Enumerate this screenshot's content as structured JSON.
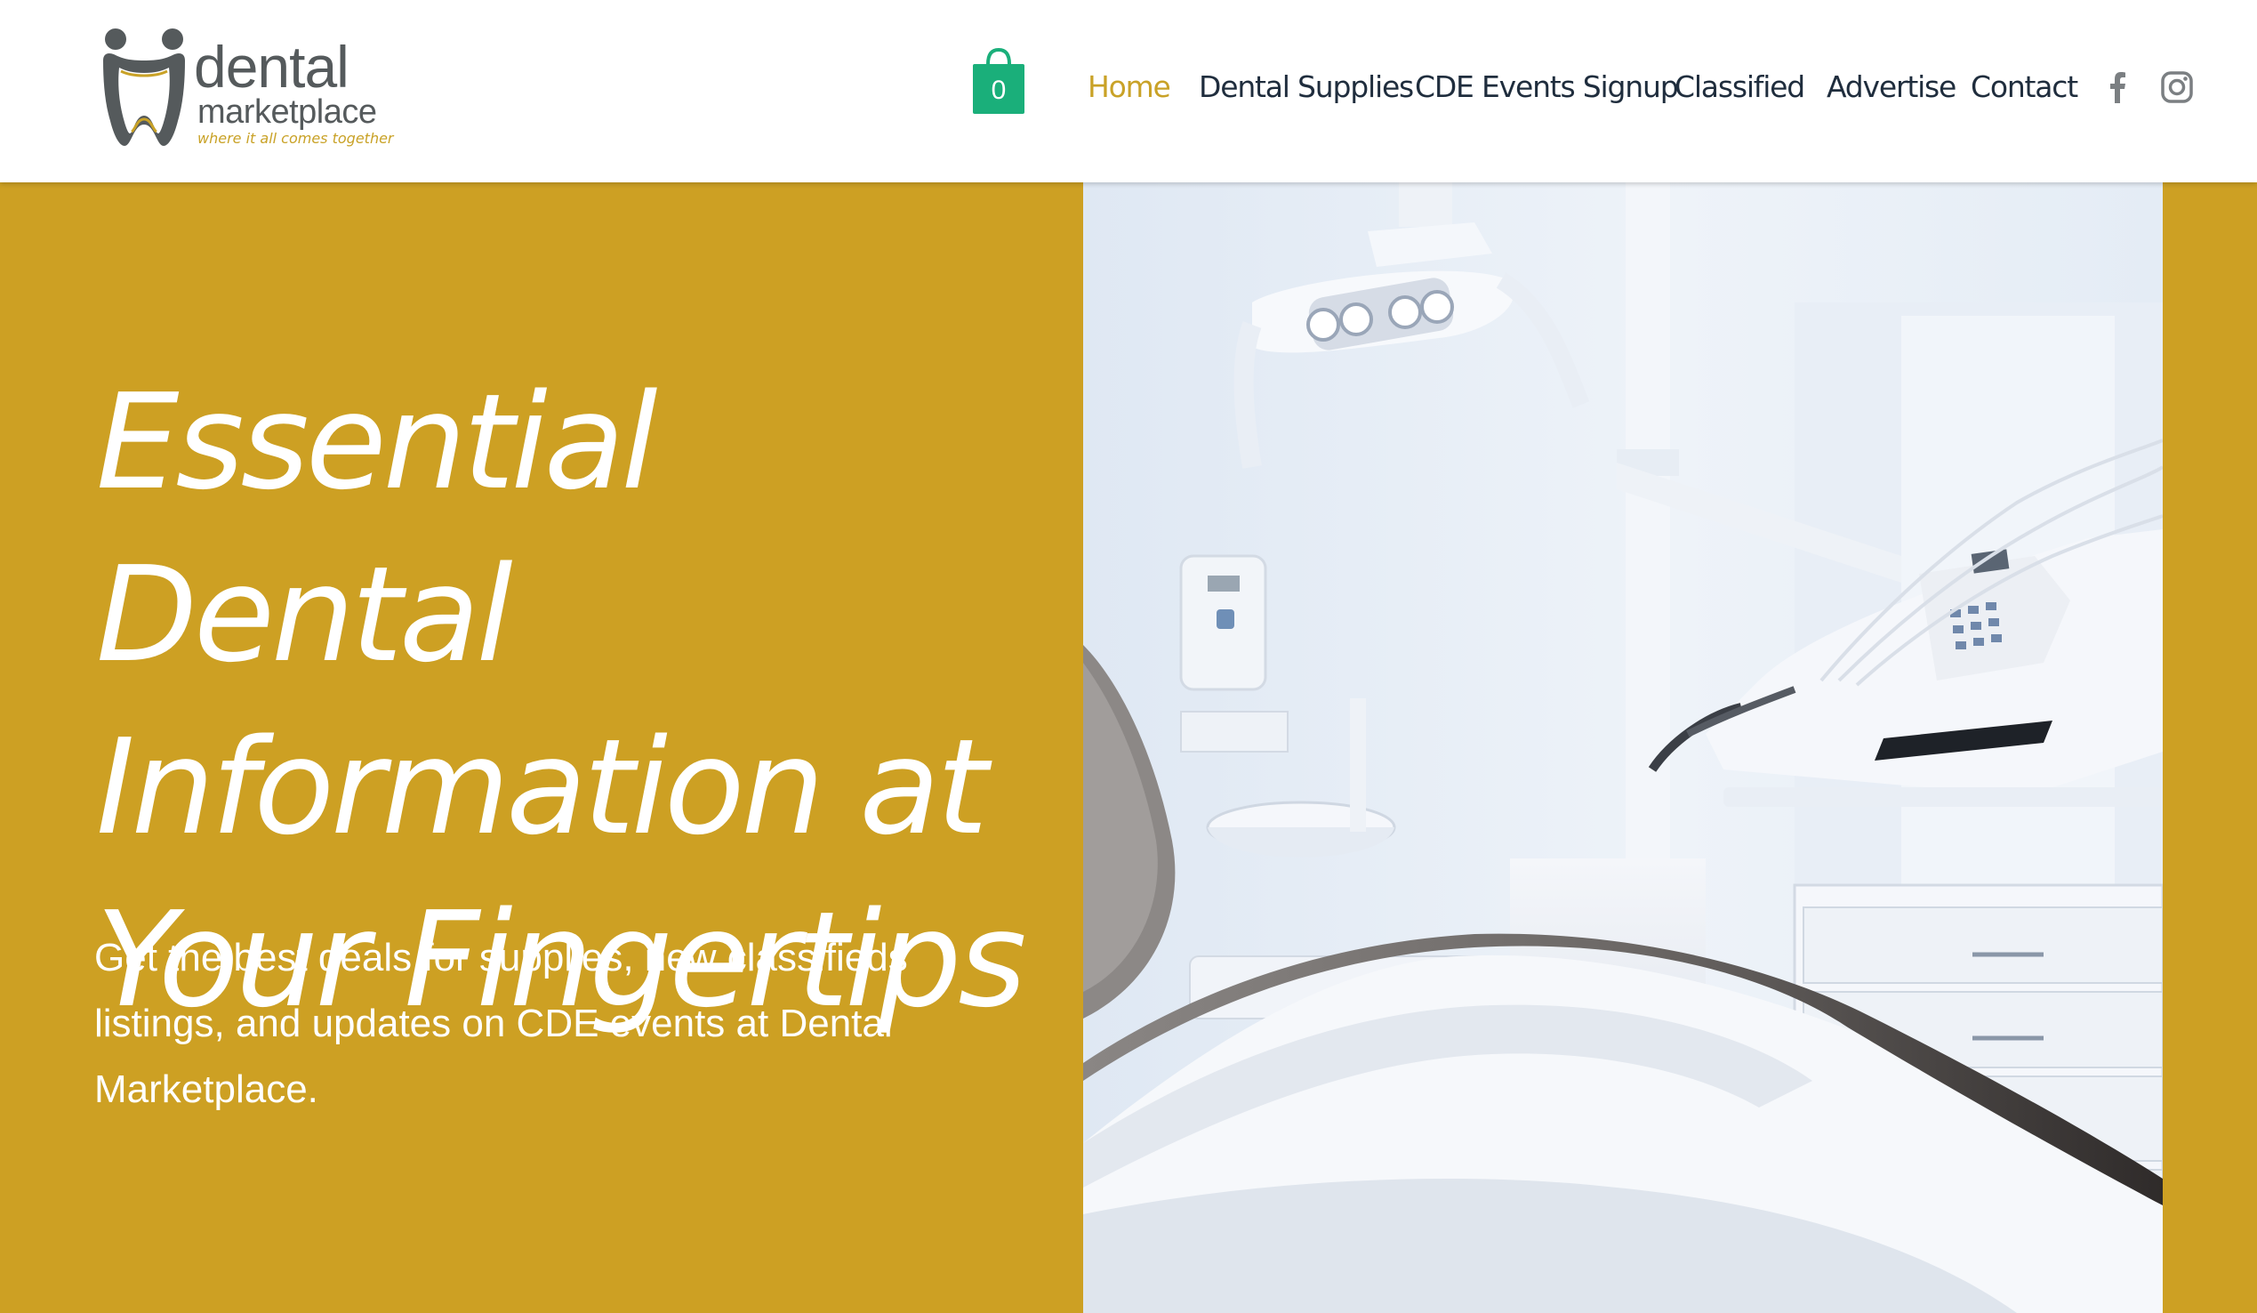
{
  "header": {
    "logo": {
      "word": "dental",
      "sub": "marketplace",
      "tagline": "where it all comes together"
    },
    "cart": {
      "count": "0",
      "icon": "shopping-bag-icon",
      "color": "#1aaf7a"
    },
    "nav": [
      {
        "label": "Home",
        "active": true
      },
      {
        "label": "Dental Supplies",
        "active": false
      },
      {
        "label": "CDE Events Signup",
        "active": false
      },
      {
        "label": "Classified",
        "active": false
      },
      {
        "label": "Advertise",
        "active": false
      },
      {
        "label": "Contact",
        "active": false
      }
    ],
    "social": [
      {
        "name": "facebook",
        "icon": "facebook-icon"
      },
      {
        "name": "instagram",
        "icon": "instagram-icon"
      }
    ]
  },
  "hero": {
    "headline_lines": [
      "Essential Dental",
      "Information at",
      "Your Fingertips"
    ],
    "subtext": "Get the best deals for supplies, new classifieds listings, and updates on CDE events at Dental Marketplace.",
    "image": "dental-office-photo"
  },
  "colors": {
    "accent_gold": "#cda023",
    "nav_active": "#c9a227",
    "nav_text": "#1f2d3d",
    "cart_green": "#1aaf7a",
    "logo_grey": "#555a5c"
  }
}
